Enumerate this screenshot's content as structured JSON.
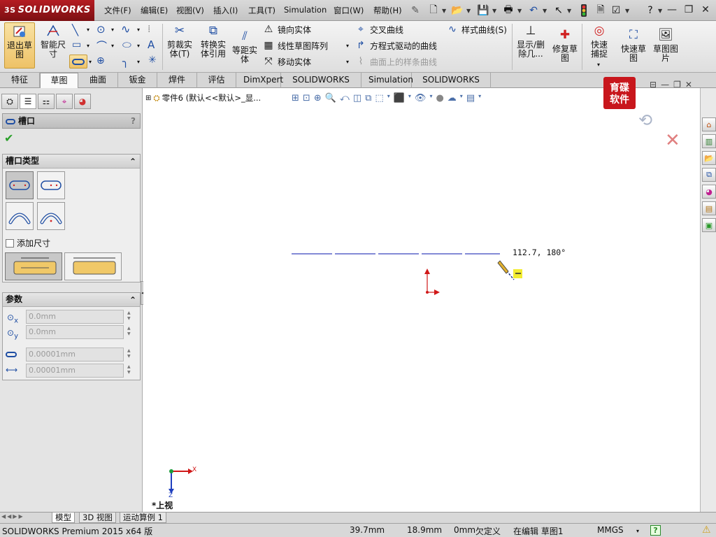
{
  "app": {
    "logo_text": "SOLIDWORKS",
    "logo_mark": "3S",
    "menus": [
      "文件(F)",
      "编辑(E)",
      "视图(V)",
      "插入(I)",
      "工具(T)",
      "Simulation",
      "窗口(W)",
      "帮助(H)"
    ],
    "help_glyph": "?"
  },
  "command_manager": {
    "exit_sketch": "退出草图",
    "smart_dimension": "智能尺寸",
    "trim": "剪裁实体(T)",
    "convert": "转换实体引用",
    "offset": "等距实体",
    "mirror": "镜向实体",
    "linear_pattern": "线性草图阵列",
    "move": "移动实体",
    "intersect_curve": "交叉曲线",
    "equation_curve": "方程式驱动的曲线",
    "face_curve": "曲面上的样条曲线",
    "style_spline": "样式曲线(S)",
    "display_delete": "显示/删除几...",
    "repair_sketch": "修复草图",
    "quick_snap": "快速捕捉",
    "rapid_sketch": "快速草图",
    "sketch_picture": "草图图片"
  },
  "tabs": [
    "特征",
    "草图",
    "曲面",
    "钣金",
    "焊件",
    "评估",
    "DimXpert",
    "SOLIDWORKS 插件",
    "Simulation",
    "SOLIDWORKS MBD"
  ],
  "active_tab": "草图",
  "property_manager": {
    "title": "槽口",
    "help": "?",
    "slot_type_header": "槽口类型",
    "add_dimensions_label": "添加尺寸",
    "params_header": "参数",
    "param_x": "0.0mm",
    "param_y": "0.0mm",
    "param_width": "0.00001mm",
    "param_length": "0.00001mm",
    "x_sub": "x",
    "y_sub": "y"
  },
  "canvas": {
    "feature_tree_label": "零件6 (默认<<默认>_显...",
    "cursor_readout": "112.7, 180°",
    "view_label": "*上视",
    "triad_x": "X",
    "triad_z": "Z",
    "watermark_line1": "育碟",
    "watermark_line2": "软件"
  },
  "bottom_tabs": [
    "模型",
    "3D 视图",
    "运动算例 1"
  ],
  "status": {
    "product": "SOLIDWORKS Premium 2015 x64 版",
    "x": "39.7mm",
    "y": "18.9mm",
    "z": "0mm",
    "definition": "欠定义",
    "editing": "在编辑 草图1",
    "units": "MMGS",
    "help_glyph": "?"
  },
  "colors": {
    "brand_red": "#a3161b",
    "sketch_line": "#5a64c8",
    "origin_red": "#d01818",
    "selection_yellow": "#f0c868"
  }
}
